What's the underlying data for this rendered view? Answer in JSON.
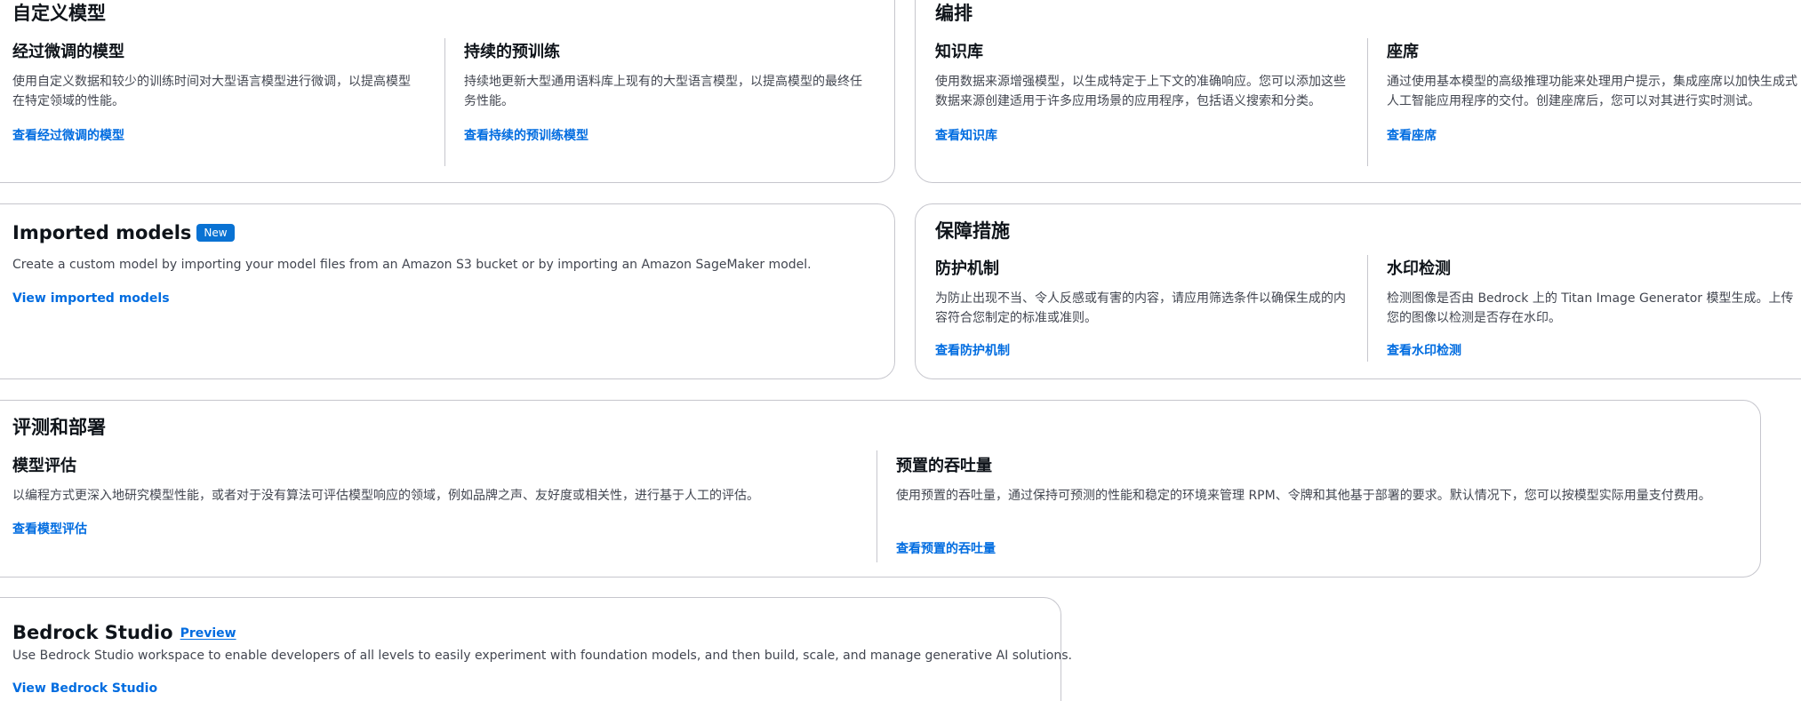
{
  "custom_models": {
    "title": "自定义模型",
    "fine_tuned": {
      "title": "经过微调的模型",
      "description": "使用自定义数据和较少的训练时间对大型语言模型进行微调，以提高模型在特定领域的性能。",
      "link": "查看经过微调的模型"
    },
    "continued_pretraining": {
      "title": "持续的预训练",
      "description": "持续地更新大型通用语料库上现有的大型语言模型，以提高模型的最终任务性能。",
      "link": "查看持续的预训练模型"
    }
  },
  "orchestration": {
    "title": "编排",
    "knowledge_base": {
      "title": "知识库",
      "description": "使用数据来源增强模型，以生成特定于上下文的准确响应。您可以添加这些数据来源创建适用于许多应用场景的应用程序，包括语义搜索和分类。",
      "link": "查看知识库"
    },
    "agents": {
      "title": "座席",
      "description": "通过使用基本模型的高级推理功能来处理用户提示，集成座席以加快生成式人工智能应用程序的交付。创建座席后，您可以对其进行实时测试。",
      "link": "查看座席"
    }
  },
  "imported_models": {
    "title": "Imported models",
    "badge": "New",
    "description": "Create a custom model by importing your model files from an Amazon S3 bucket or by importing an Amazon SageMaker model.",
    "link": "View imported models"
  },
  "safeguards": {
    "title": "保障措施",
    "guardrails": {
      "title": "防护机制",
      "description": "为防止出现不当、令人反感或有害的内容，请应用筛选条件以确保生成的内容符合您制定的标准或准则。",
      "link": "查看防护机制"
    },
    "watermark": {
      "title": "水印检测",
      "description": "检测图像是否由 Bedrock 上的 Titan Image Generator 模型生成。上传您的图像以检测是否存在水印。",
      "link": "查看水印检测"
    }
  },
  "evaluation": {
    "title": "评测和部署",
    "model_eval": {
      "title": "模型评估",
      "description": "以编程方式更深入地研究模型性能，或者对于没有算法可评估模型响应的领域，例如品牌之声、友好度或相关性，进行基于人工的评估。",
      "link": "查看模型评估"
    },
    "provisioned": {
      "title": "预置的吞吐量",
      "description": "使用预置的吞吐量，通过保持可预测的性能和稳定的环境来管理 RPM、令牌和其他基于部署的要求。默认情况下，您可以按模型实际用量支付费用。",
      "link": "查看预置的吞吐量"
    }
  },
  "bedrock_studio": {
    "title": "Bedrock Studio",
    "badge": "Preview",
    "description": "Use Bedrock Studio workspace to enable developers of all levels to easily experiment with foundation models, and then build, scale, and manage generative AI solutions.",
    "link": "View Bedrock Studio"
  }
}
